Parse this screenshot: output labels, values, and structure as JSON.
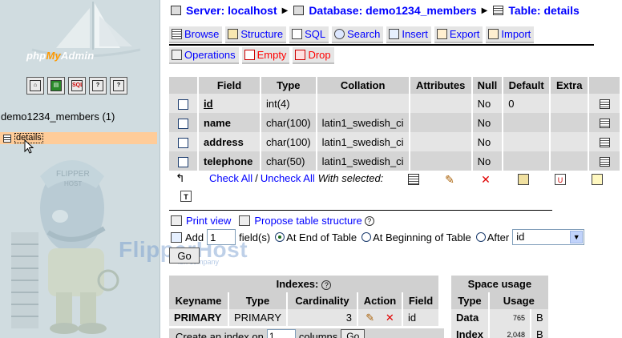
{
  "left": {
    "logo_text_php": "php",
    "logo_text_my": "My",
    "logo_text_admin": "Admin",
    "icons": [
      "home-icon",
      "query-window-icon",
      "sql-icon",
      "docs-icon",
      "docs-sql-icon"
    ],
    "db_title": "demo1234_members (1)",
    "tables": [
      {
        "label": "details",
        "selected": true
      }
    ]
  },
  "watermark": {
    "text": "FlipperHost",
    "sub": "ion company"
  },
  "breadcrumb": {
    "server": "Server: localhost",
    "database": "Database: demo1234_members",
    "table": "Table: details"
  },
  "tabs_row1": [
    "Browse",
    "Structure",
    "SQL",
    "Search",
    "Insert",
    "Export",
    "Import"
  ],
  "tabs_row2": [
    "Operations",
    "Empty",
    "Drop"
  ],
  "structure": {
    "headers": [
      "Field",
      "Type",
      "Collation",
      "Attributes",
      "Null",
      "Default",
      "Extra"
    ],
    "rows": [
      {
        "field": "id",
        "type": "int(4)",
        "collation": "",
        "attributes": "",
        "null": "No",
        "default": "0",
        "extra": ""
      },
      {
        "field": "name",
        "type": "char(100)",
        "collation": "latin1_swedish_ci",
        "attributes": "",
        "null": "No",
        "default": "",
        "extra": ""
      },
      {
        "field": "address",
        "type": "char(100)",
        "collation": "latin1_swedish_ci",
        "attributes": "",
        "null": "No",
        "default": "",
        "extra": ""
      },
      {
        "field": "telephone",
        "type": "char(50)",
        "collation": "latin1_swedish_ci",
        "attributes": "",
        "null": "No",
        "default": "",
        "extra": ""
      }
    ]
  },
  "bulk": {
    "check_all": "Check All",
    "slash": "/",
    "uncheck_all": "Uncheck All",
    "with_selected": "With selected:"
  },
  "links": {
    "print_view": "Print view",
    "propose": "Propose table structure"
  },
  "add_field": {
    "add_label": "Add",
    "count": "1",
    "fields_label": "field(s)",
    "opt_end": "At End of Table",
    "opt_begin": "At Beginning of Table",
    "opt_after": "After",
    "after_value": "id",
    "go": "Go"
  },
  "indexes": {
    "title": "Indexes:",
    "headers": [
      "Keyname",
      "Type",
      "Cardinality",
      "Action",
      "Field"
    ],
    "rows": [
      {
        "keyname": "PRIMARY",
        "type": "PRIMARY",
        "cardinality": "3",
        "field": "id"
      }
    ],
    "create_prefix": "Create an index on",
    "create_count": "1",
    "create_suffix": "columns",
    "create_go": "Go"
  },
  "space": {
    "title": "Space usage",
    "headers": [
      "Type",
      "Usage"
    ],
    "rows": [
      {
        "type": "Data",
        "usage": "765",
        "unit": "B"
      },
      {
        "type": "Index",
        "usage": "2,048",
        "unit": "B"
      }
    ]
  }
}
